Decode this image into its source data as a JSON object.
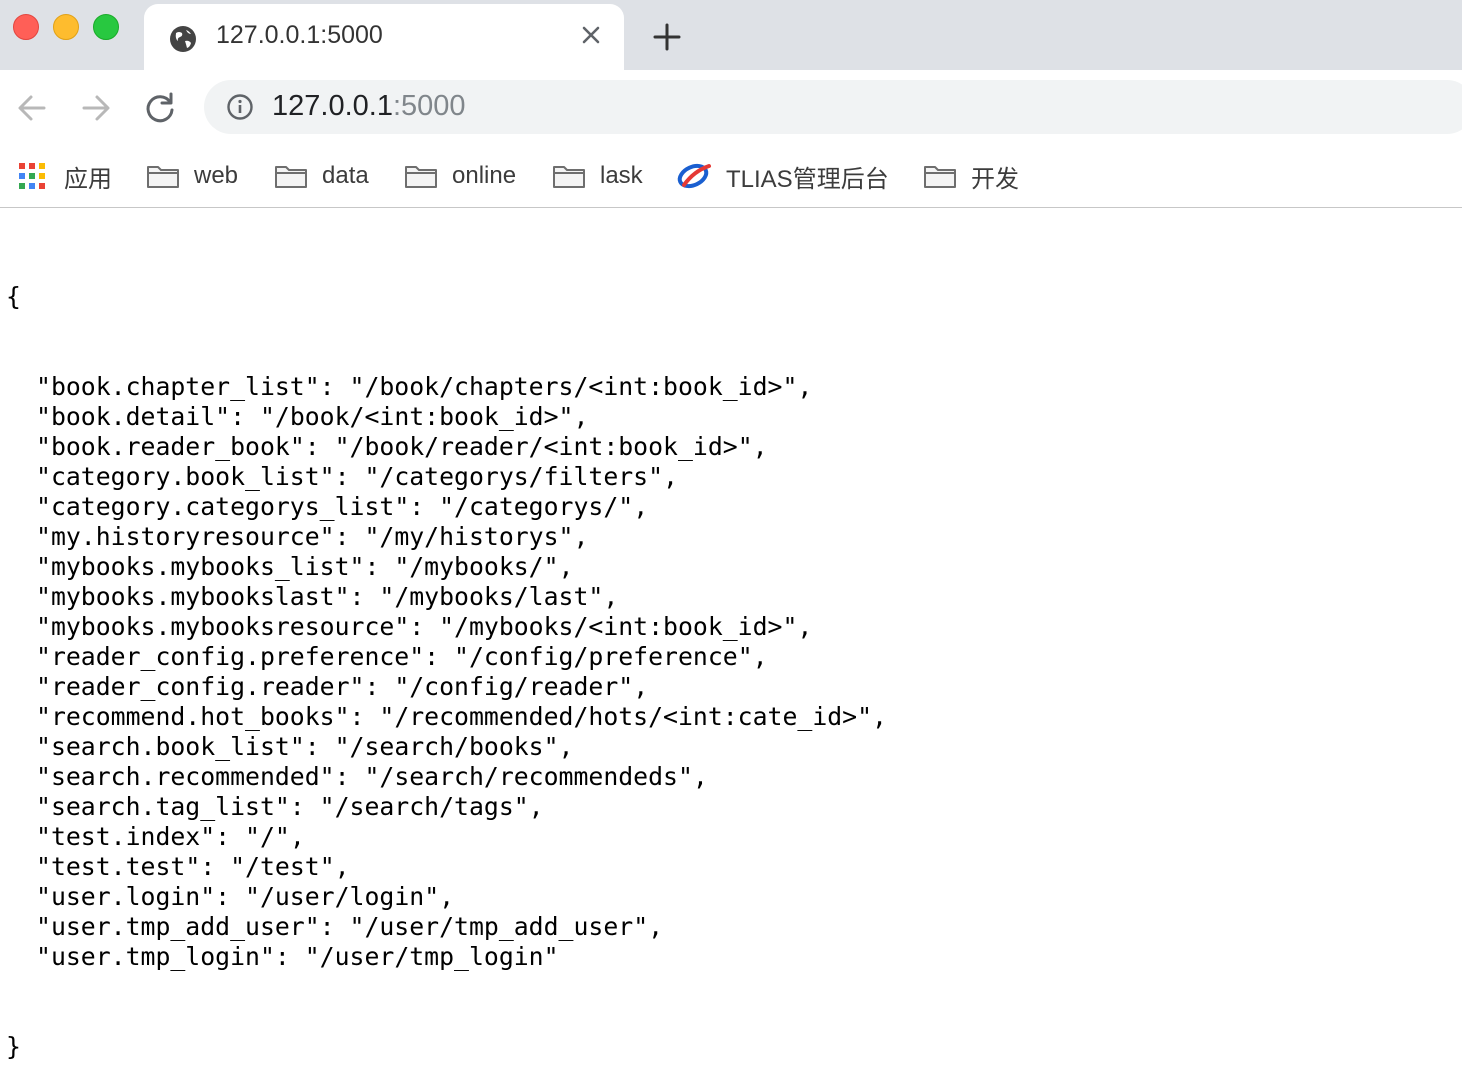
{
  "tab": {
    "title": "127.0.0.1:5000",
    "icon": "globe-icon"
  },
  "address_bar": {
    "host": "127.0.0.1",
    "port": ":5000"
  },
  "bookmarks": [
    {
      "label": "应用",
      "icon": "apps-grid-icon"
    },
    {
      "label": "web",
      "icon": "folder-icon"
    },
    {
      "label": "data",
      "icon": "folder-icon"
    },
    {
      "label": "online",
      "icon": "folder-icon"
    },
    {
      "label": "lask",
      "icon": "folder-icon"
    },
    {
      "label": "TLIAS管理后台",
      "icon": "tlias-logo-icon"
    },
    {
      "label": "开发",
      "icon": "folder-icon"
    }
  ],
  "json": {
    "open_brace": "{",
    "close_brace": "}",
    "entries": [
      {
        "key": "book.chapter_list",
        "value": "/book/chapters/<int:book_id>"
      },
      {
        "key": "book.detail",
        "value": "/book/<int:book_id>"
      },
      {
        "key": "book.reader_book",
        "value": "/book/reader/<int:book_id>"
      },
      {
        "key": "category.book_list",
        "value": "/categorys/filters"
      },
      {
        "key": "category.categorys_list",
        "value": "/categorys/"
      },
      {
        "key": "my.historyresource",
        "value": "/my/historys"
      },
      {
        "key": "mybooks.mybooks_list",
        "value": "/mybooks/"
      },
      {
        "key": "mybooks.mybookslast",
        "value": "/mybooks/last"
      },
      {
        "key": "mybooks.mybooksresource",
        "value": "/mybooks/<int:book_id>"
      },
      {
        "key": "reader_config.preference",
        "value": "/config/preference"
      },
      {
        "key": "reader_config.reader",
        "value": "/config/reader"
      },
      {
        "key": "recommend.hot_books",
        "value": "/recommended/hots/<int:cate_id>"
      },
      {
        "key": "search.book_list",
        "value": "/search/books"
      },
      {
        "key": "search.recommended",
        "value": "/search/recommendeds"
      },
      {
        "key": "search.tag_list",
        "value": "/search/tags"
      },
      {
        "key": "test.index",
        "value": "/"
      },
      {
        "key": "test.test",
        "value": "/test"
      },
      {
        "key": "user.login",
        "value": "/user/login"
      },
      {
        "key": "user.tmp_add_user",
        "value": "/user/tmp_add_user"
      },
      {
        "key": "user.tmp_login",
        "value": "/user/tmp_login"
      }
    ]
  },
  "colors": {
    "tabstrip": "#dee1e6",
    "omnibox": "#f1f3f4",
    "close": "#ff5f57",
    "minimize": "#febc2e",
    "maximize": "#28c840",
    "tlias": "#1a5fd0"
  }
}
